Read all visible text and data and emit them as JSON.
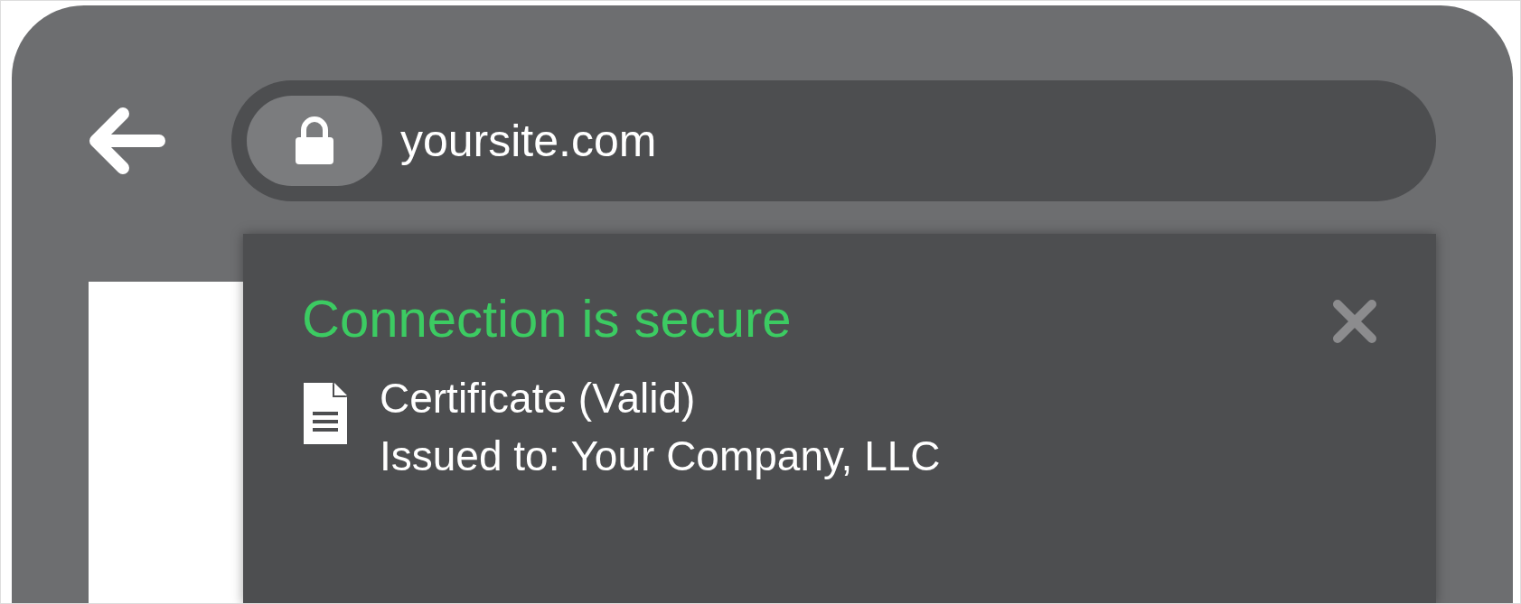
{
  "address_bar": {
    "url": "yoursite.com"
  },
  "popup": {
    "title": "Connection is secure",
    "certificate": "Certificate (Valid)",
    "issued_to": "Issued to: Your Company, LLC"
  }
}
